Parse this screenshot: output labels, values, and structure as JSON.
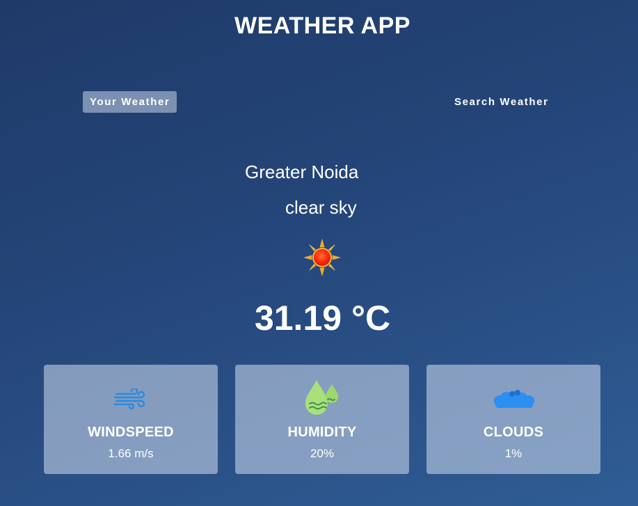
{
  "header": {
    "title": "WEATHER APP"
  },
  "tabs": [
    {
      "label": "Your Weather",
      "active": true
    },
    {
      "label": "Search Weather",
      "active": false
    }
  ],
  "weather": {
    "city": "Greater Noida",
    "description": "clear sky",
    "icon": "sun-icon",
    "temperature": "31.19 °C"
  },
  "stats": {
    "windspeed": {
      "label": "WINDSPEED",
      "value": "1.66 m/s",
      "icon": "wind-icon"
    },
    "humidity": {
      "label": "HUMIDITY",
      "value": "20%",
      "icon": "humidity-drops-icon"
    },
    "clouds": {
      "label": "CLOUDS",
      "value": "1%",
      "icon": "cloud-icon"
    }
  },
  "colors": {
    "background_top": "#1e3a68",
    "background_bottom": "#2f5d95",
    "card_background": "#8aa0c0",
    "active_tab": "#8a9ebd"
  }
}
